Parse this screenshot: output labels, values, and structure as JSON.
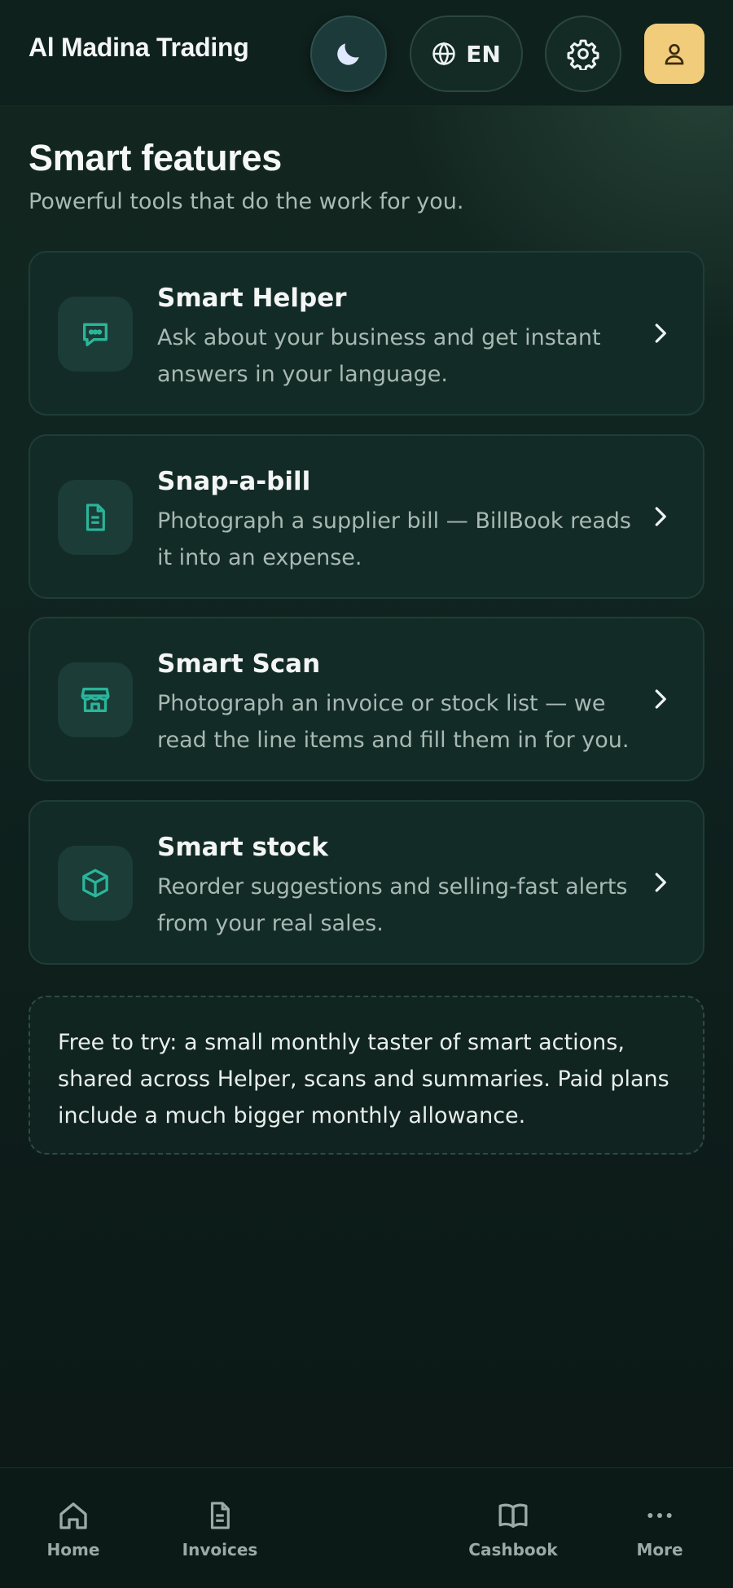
{
  "header": {
    "business_name": "Al Madina Trading",
    "language_label": "EN",
    "icons": [
      "moon-icon",
      "globe-icon",
      "gear-icon",
      "user-icon"
    ]
  },
  "page": {
    "title": "Smart features",
    "subtitle": "Powerful tools that do the work for you."
  },
  "features": [
    {
      "title": "Smart Helper",
      "description": "Ask about your business and get instant answers in your language.",
      "icon": "chat-bubble-icon"
    },
    {
      "title": "Snap-a-bill",
      "description": "Photograph a supplier bill — BillBook reads it into an expense.",
      "icon": "document-icon"
    },
    {
      "title": "Smart Scan",
      "description": "Photograph an invoice or stock list — we read the line items and fill them in for you.",
      "icon": "store-icon"
    },
    {
      "title": "Smart stock",
      "description": "Reorder suggestions and selling-fast alerts from your real sales.",
      "icon": "box-icon"
    }
  ],
  "note": {
    "text": "Free to try: a small monthly taster of smart actions, shared across Helper, scans and summaries. Paid plans include a much bigger monthly allowance."
  },
  "bottom_nav": {
    "items": [
      {
        "label": "Home",
        "icon": "home-icon"
      },
      {
        "label": "Invoices",
        "icon": "document-icon"
      },
      {
        "label": "Cashbook",
        "icon": "book-icon"
      },
      {
        "label": "More",
        "icon": "more-dots-icon"
      }
    ]
  },
  "colors": {
    "accent": "#2bb59a",
    "avatar_bg": "#f1cc7a",
    "card_bg": "#132b27",
    "page_bg": "#0d1d1a"
  }
}
